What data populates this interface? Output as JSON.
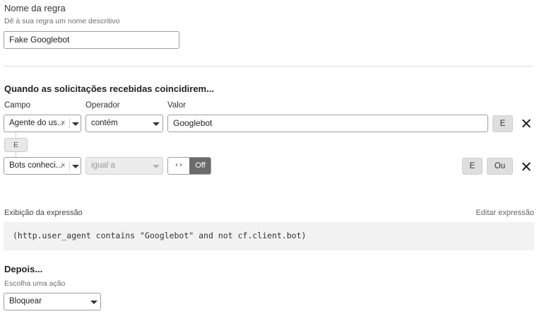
{
  "rule_name": {
    "label": "Nome da regra",
    "hint": "Dê à sua regra um nome descritivo",
    "value": "Fake Googlebot"
  },
  "when": {
    "heading": "Quando as solicitações recebidas coincidirem...",
    "col_field": "Campo",
    "col_operator": "Operador",
    "col_value": "Valor",
    "row1": {
      "field": "Agente do us...",
      "clear": "×",
      "operator": "contém",
      "value": "Googlebot",
      "and_button": "E"
    },
    "connector": "E",
    "row2": {
      "field": "Bots conheci...",
      "clear": "×",
      "operator": "igual a",
      "toggle_icon": "‹›",
      "toggle_state": "Off",
      "and_button": "E",
      "or_button": "Ou"
    }
  },
  "expression": {
    "label": "Exibição da expressão",
    "edit_link": "Editar expressão",
    "text": "(http.user_agent contains \"Googlebot\" and not cf.client.bot)"
  },
  "then": {
    "heading": "Depois...",
    "hint": "Escolha uma ação",
    "action": "Bloquear"
  },
  "colors": {
    "toggle_off_bg": "#6b6b6b",
    "button_gray": "#dedede",
    "expression_bg": "#f2f2f2"
  },
  "icons": {
    "remove": "close-icon",
    "dropdown": "chevron-down-icon",
    "toggle": "code-arrows-icon"
  }
}
